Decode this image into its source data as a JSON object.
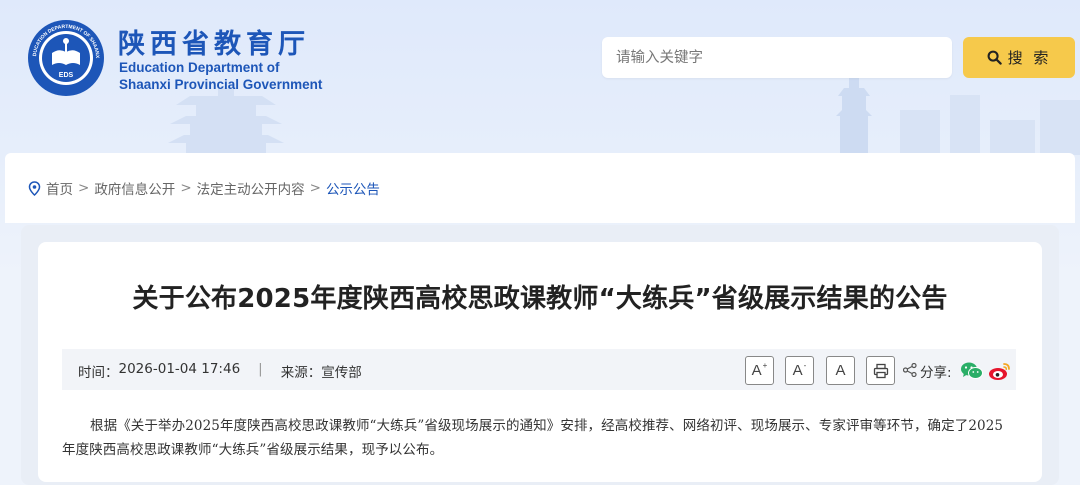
{
  "header": {
    "site_name_cn": "陕西省教育厅",
    "site_name_en_line1": "Education Department of",
    "site_name_en_line2": "Shaanxi Provincial Government",
    "emblem_text": "EDS",
    "emblem_ring_text": "EDUCATION DEPARTMENT OF SHAANXI",
    "search": {
      "placeholder": "请输入关键字",
      "value": ""
    },
    "search_button_label": "搜 索"
  },
  "breadcrumb": {
    "items": [
      {
        "label": "首页"
      },
      {
        "label": "政府信息公开"
      },
      {
        "label": "法定主动公开内容"
      },
      {
        "label": "公示公告"
      }
    ],
    "separator": ">"
  },
  "article": {
    "title": "关于公布2025年度陕西高校思政课教师“大练兵”省级展示结果的公告",
    "meta": {
      "time_label": "时间：",
      "time_value": "2026-01-04 17:46",
      "divider": "|",
      "source_label": "来源：",
      "source_value": "宣传部"
    },
    "tools": {
      "font_large": "A",
      "font_medium": "A",
      "font_small": "A",
      "share_label": "分享:"
    },
    "body": "根据《关于举办2025年度陕西高校思政课教师“大练兵”省级现场展示的通知》安排，经高校推荐、网络初评、现场展示、专家评审等环节，确定了2025年度陕西高校思政课教师“大练兵”省级展示结果，现予以公布。"
  },
  "colors": {
    "brand_blue": "#1d56b8",
    "search_button": "#f6c94b",
    "wechat_green": "#2aae67",
    "weibo_red": "#e6162d"
  },
  "icons": [
    "location-pin-icon",
    "search-icon",
    "print-icon",
    "share-icon",
    "wechat-icon",
    "weibo-icon"
  ]
}
